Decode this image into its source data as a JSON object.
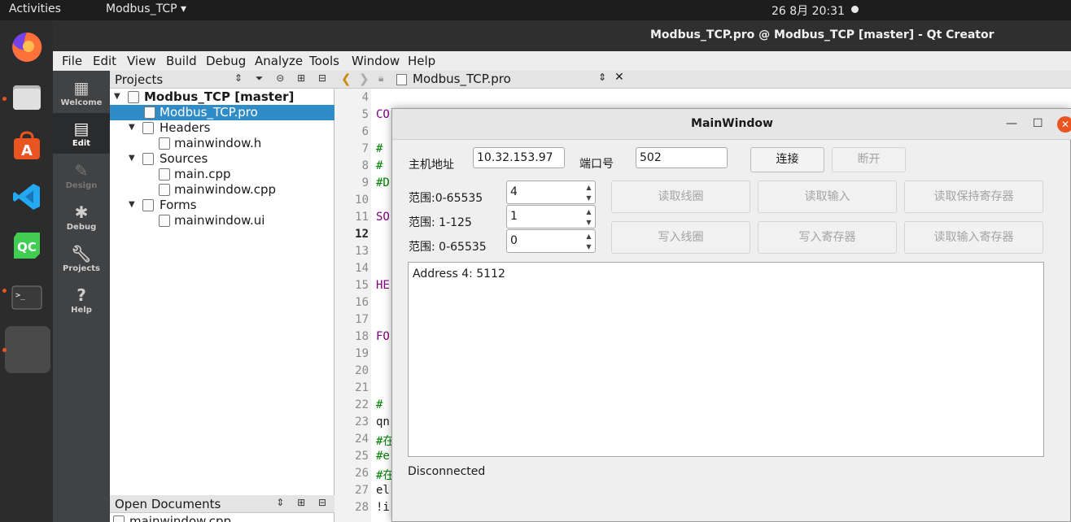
{
  "topbar": {
    "activities": "Activities",
    "app_menu": "Modbus_TCP ▾",
    "clock": "26 8月  20:31"
  },
  "dock": {
    "items": [
      "firefox-icon",
      "files-icon",
      "software-icon",
      "vscode-icon",
      "qtcreator-icon",
      "terminal-icon",
      "apps-icon"
    ]
  },
  "qt": {
    "title": "Modbus_TCP.pro @ Modbus_TCP [master] - Qt Creator",
    "menu": [
      "File",
      "Edit",
      "View",
      "Build",
      "Debug",
      "Analyze",
      "Tools",
      "Window",
      "Help"
    ],
    "modes": [
      "Welcome",
      "Edit",
      "Design",
      "Debug",
      "Projects",
      "Help"
    ],
    "projects_header": "Projects",
    "tree": [
      "Modbus_TCP [master]",
      "Modbus_TCP.pro",
      "Headers",
      "mainwindow.h",
      "Sources",
      "main.cpp",
      "mainwindow.cpp",
      "Forms",
      "mainwindow.ui"
    ],
    "open_documents_header": "Open Documents",
    "open_doc_item": "mainwindow.cpp",
    "editor_tab": "Modbus_TCP.pro",
    "line_numbers": [
      "4",
      "5",
      "6",
      "7",
      "8",
      "9",
      "10",
      "11",
      "12",
      "13",
      "14",
      "15",
      "16",
      "17",
      "18",
      "19",
      "20",
      "21",
      "22",
      "23",
      "24",
      "25",
      "26",
      "27",
      "28"
    ],
    "code_fragments": {
      "l5": "CO",
      "l7": "#",
      "l8": "#",
      "l9": "#D",
      "l11": "SO",
      "l15": "HE",
      "l18": "FO",
      "l21": "#",
      "l22": "qn",
      "l23": "#在",
      "l24": "#e",
      "l25": "#在",
      "l26": "el",
      "l27": "!i"
    }
  },
  "mainwindow": {
    "title": "MainWindow",
    "host_label": "主机地址",
    "host_value": "10.32.153.97",
    "port_label": "端口号",
    "port_value": "502",
    "connect_button": "连接",
    "disconnect_button": "断开",
    "range1_label": "范围:0-65535",
    "range1_value": "4",
    "range2_label": "范围: 1-125",
    "range2_value": "1",
    "range3_label": "范围: 0-65535",
    "range3_value": "0",
    "buttons": {
      "read_coils": "读取线圈",
      "read_inputs": "读取输入",
      "read_holding": "读取保持寄存器",
      "write_coils": "写入线圈",
      "write_registers": "写入寄存器",
      "read_input_registers": "读取输入寄存器"
    },
    "output_text": "Address 4: 5112",
    "status": "Disconnected"
  }
}
